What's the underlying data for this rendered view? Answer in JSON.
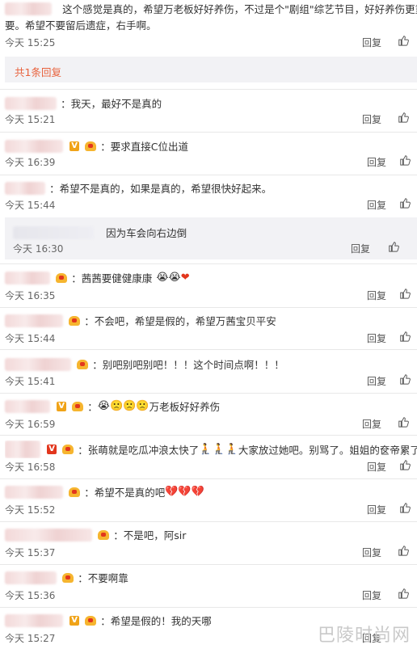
{
  "top_comment": {
    "text_line1": "这个感觉是真的，希望万老板好好养伤，不过是个\"剧组\"综艺节目，好好养伤更重",
    "text_line2": "要。希望不要留后遗症，右手啊。",
    "time": "今天 15:25",
    "reply_label": "回复",
    "replies_summary": "共1条回复"
  },
  "comments": [
    {
      "sep": "：",
      "text": "我天，最好不是真的",
      "time": "今天 15:21",
      "reply_label": "回复"
    },
    {
      "sep": "：",
      "text": "要求直接C位出道",
      "time": "今天 16:39",
      "reply_label": "回复"
    },
    {
      "sep": "：",
      "text": "希望不是真的，如果是真的，希望很快好起来。",
      "time": "今天 15:44",
      "reply_label": "回复"
    },
    {
      "text": "因为车会向右边倒",
      "time": "今天 16:30",
      "reply_label": "回复"
    },
    {
      "sep": "：",
      "text": "茜茜要健健康康",
      "time": "今天 16:35",
      "reply_label": "回复"
    },
    {
      "sep": "：",
      "text": "不会吧，希望是假的，希望万茜宝贝平安",
      "time": "今天 15:44",
      "reply_label": "回复"
    },
    {
      "sep": "：",
      "text": "别吧别吧别吧！！！这个时间点啊！！！",
      "time": "今天 15:41",
      "reply_label": "回复"
    },
    {
      "sep": "：",
      "text": "万老板好好养伤",
      "time": "今天 16:59",
      "reply_label": "回复"
    },
    {
      "sep": "：",
      "text_a": "张萌就是吃瓜冲浪太快了",
      "text_b": "大家放过她吧。别骂了。姐姐的奁帝累了",
      "time": "今天 16:58",
      "reply_label": "回复"
    },
    {
      "sep": "：",
      "text": "希望不是真的吧",
      "time": "今天 15:52",
      "reply_label": "回复"
    },
    {
      "sep": "：",
      "text": "不是吧，阿sir",
      "time": "今天 15:37",
      "reply_label": "回复"
    },
    {
      "sep": "：",
      "text": "不要啊靠",
      "time": "今天 15:36",
      "reply_label": "回复"
    },
    {
      "sep": "：",
      "text": "希望是假的！我的天哪",
      "time": "今天 15:27",
      "reply_label": "回复"
    }
  ],
  "emoji": {
    "cry": "😭",
    "heart": "❤",
    "sad": "🙁",
    "broken_heart": "💔",
    "person": "🧎"
  },
  "watermark": "巴陵时尚网",
  "colors": {
    "reply_summary": "#e8613c",
    "accent_red": "#e2361d",
    "badge_orange": "#f0a318"
  }
}
